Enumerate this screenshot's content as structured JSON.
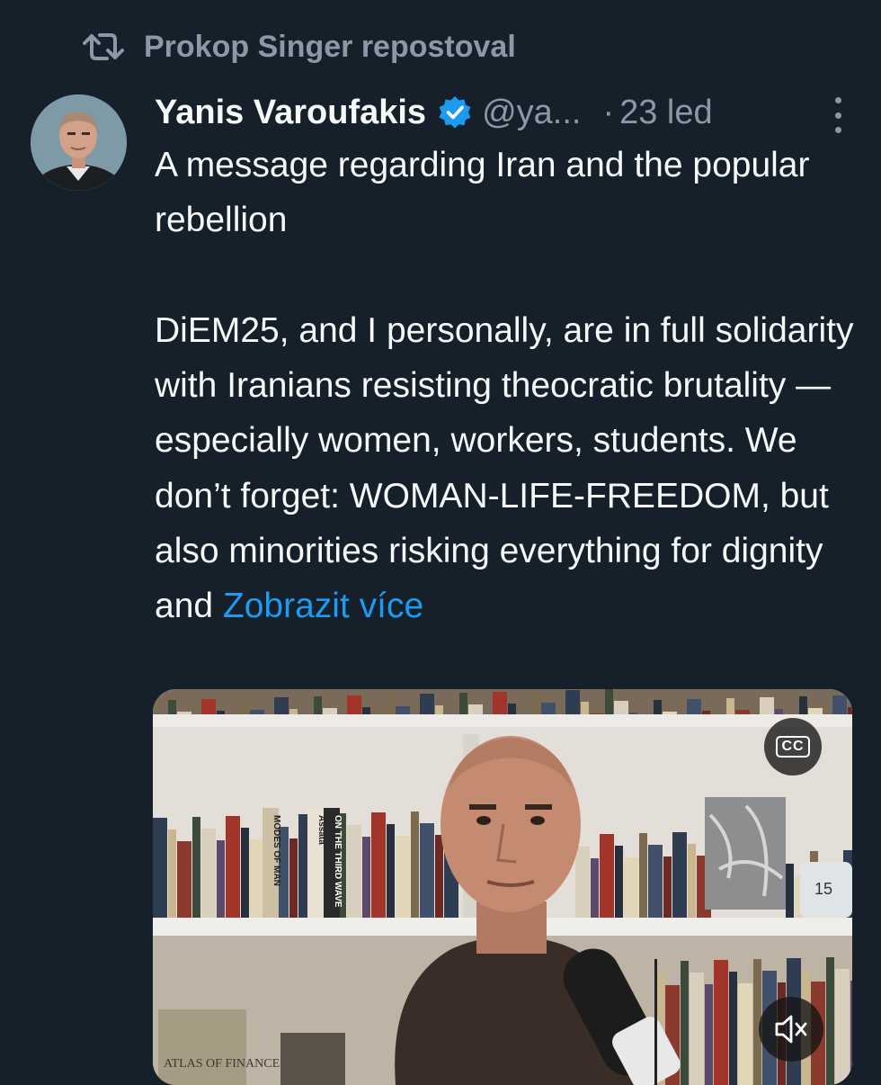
{
  "repost": {
    "icon": "repost-icon",
    "text": "Prokop Singer repostoval"
  },
  "author": {
    "avatar": "author-avatar",
    "name": "Yanis Varoufakis",
    "verified_icon": "verified-badge-icon",
    "handle": "@ya...",
    "separator": "·",
    "date": "23 led"
  },
  "more_icon": "more-options-icon",
  "tweet": {
    "paragraph1": "A message regarding Iran and the popular rebellion",
    "paragraph2": "DiEM25, and I personally, are in full solidarity with Iranians resisting theocratic brutality — especially women, workers, students. We don’t forget: WOMAN-LIFE-FREEDOM, but also minorities risking everything for dignity and",
    "show_more": "Zobrazit více"
  },
  "media": {
    "type": "video",
    "cc_label": "CC",
    "mute_icon": "volume-muted-icon",
    "clock_value": "15",
    "book_spines": [
      "Assata",
      "ON THE THIRD WAVE",
      "MODES OF MAN",
      "ATLAS OF FINANCE"
    ]
  },
  "colors": {
    "background": "#15202b",
    "text_primary": "#f7f9f9",
    "text_secondary": "#8b98a5",
    "link": "#1d9bf0",
    "verified": "#1d9bf0"
  }
}
